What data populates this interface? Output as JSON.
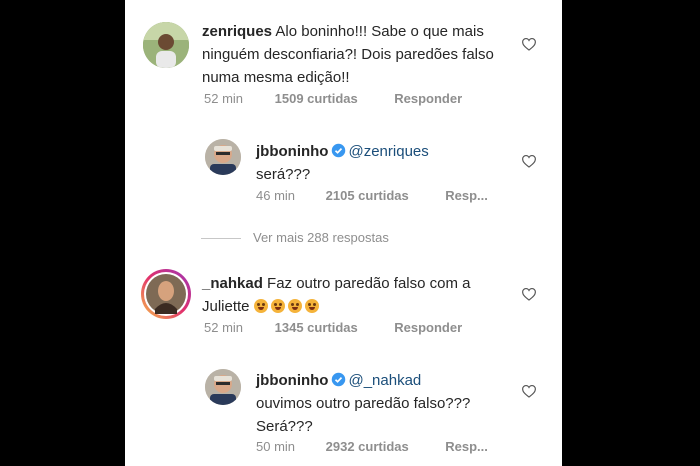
{
  "comments": [
    {
      "username": "zenriques",
      "text": "Alo boninho!!! Sabe o que mais ninguém desconfiaria?! Dois paredões falso numa mesma edição!!",
      "time": "52 min",
      "likes": "1509 curtidas",
      "reply": "Responder",
      "replies": [
        {
          "username": "jbboninho",
          "verified": true,
          "mention": "@zenriques",
          "text": "será???",
          "time": "46 min",
          "likes": "2105 curtidas",
          "reply": "Resp..."
        }
      ]
    },
    {
      "username": "_nahkad",
      "text": "Faz outro paredão falso com a Juliette",
      "emoji_count": 4,
      "time": "52 min",
      "likes": "1345 curtidas",
      "reply": "Responder",
      "replies": [
        {
          "username": "jbboninho",
          "verified": true,
          "mention": "@_nahkad",
          "text": "ouvimos outro paredão falso??? Será???",
          "time": "50 min",
          "likes": "2932 curtidas",
          "reply": "Resp..."
        }
      ]
    }
  ],
  "view_more": "Ver mais 288 respostas",
  "colors": {
    "mention": "#1b4e7a",
    "verified": "#3897f0",
    "meta": "#8e8e8e"
  }
}
